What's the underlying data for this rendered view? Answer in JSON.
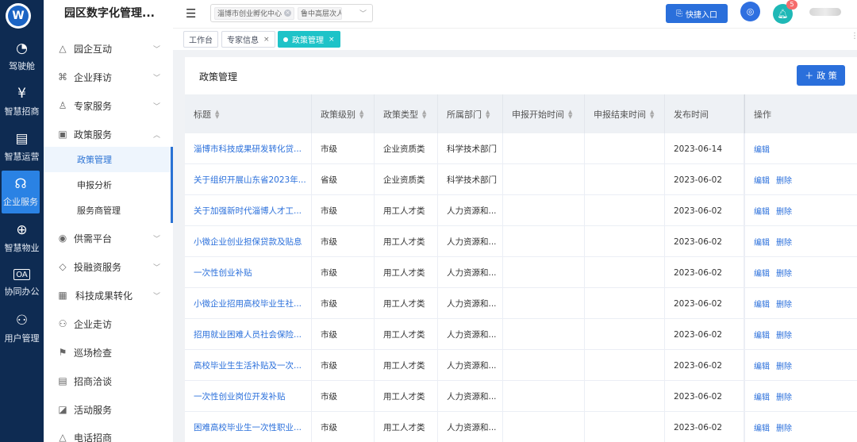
{
  "rail": {
    "logo": "W",
    "items": [
      {
        "label": "驾驶舱",
        "icon": "◔"
      },
      {
        "label": "智慧招商",
        "icon": "¥"
      },
      {
        "label": "智慧运营",
        "icon": "▤"
      },
      {
        "label": "企业服务",
        "icon": "☊"
      },
      {
        "label": "智慧物业",
        "icon": "⊕"
      },
      {
        "label": "协同办公",
        "icon": "OA"
      },
      {
        "label": "用户管理",
        "icon": "⚇"
      }
    ]
  },
  "sidebar": {
    "title": "园区数字化管理...",
    "menus": [
      {
        "label": "园企互动",
        "icon": "△"
      },
      {
        "label": "企业拜访",
        "icon": "⌘"
      },
      {
        "label": "专家服务",
        "icon": "♙"
      },
      {
        "label": "政策服务",
        "icon": "▣"
      },
      {
        "label": "供需平台",
        "icon": "◉"
      },
      {
        "label": "投融资服务",
        "icon": "◇"
      },
      {
        "label": "科技成果转化",
        "icon": "▦"
      },
      {
        "label": "企业走访",
        "icon": "⚇"
      },
      {
        "label": "巡场检查",
        "icon": "⚑"
      },
      {
        "label": "招商洽谈",
        "icon": "▤"
      },
      {
        "label": "活动服务",
        "icon": "◪"
      },
      {
        "label": "电话招商",
        "icon": "△"
      }
    ],
    "submenus": [
      "政策管理",
      "申报分析",
      "服务商管理"
    ]
  },
  "header": {
    "tags": [
      "淄博市创业孵化中心",
      "鲁中高层次人才"
    ],
    "quick_label": "快捷入口",
    "badge_count": "5"
  },
  "tabs": [
    {
      "label": "工作台"
    },
    {
      "label": "专家信息"
    },
    {
      "label": "政策管理"
    }
  ],
  "card": {
    "title": "政策管理",
    "add_label": "政 策",
    "columns": [
      "标题",
      "政策级别",
      "政策类型",
      "所属部门",
      "申报开始时间",
      "申报结束时间",
      "发布时间",
      "操作"
    ],
    "edit_label": "编辑",
    "delete_label": "删除",
    "rows": [
      {
        "title": "淄博市科技成果研发转化贷...",
        "level": "市级",
        "type": "企业资质类",
        "dept": "科学技术部门",
        "start": "",
        "end": "",
        "date": "2023-06-14",
        "can_delete": false
      },
      {
        "title": "关于组织开展山东省2023年...",
        "level": "省级",
        "type": "企业资质类",
        "dept": "科学技术部门",
        "start": "",
        "end": "",
        "date": "2023-06-02",
        "can_delete": true
      },
      {
        "title": "关于加强新时代淄博人才工...",
        "level": "市级",
        "type": "用工人才类",
        "dept": "人力资源和...",
        "start": "",
        "end": "",
        "date": "2023-06-02",
        "can_delete": true
      },
      {
        "title": "小微企业创业担保贷款及贴息",
        "level": "市级",
        "type": "用工人才类",
        "dept": "人力资源和...",
        "start": "",
        "end": "",
        "date": "2023-06-02",
        "can_delete": true
      },
      {
        "title": "一次性创业补贴",
        "level": "市级",
        "type": "用工人才类",
        "dept": "人力资源和...",
        "start": "",
        "end": "",
        "date": "2023-06-02",
        "can_delete": true
      },
      {
        "title": "小微企业招用高校毕业生社...",
        "level": "市级",
        "type": "用工人才类",
        "dept": "人力资源和...",
        "start": "",
        "end": "",
        "date": "2023-06-02",
        "can_delete": true
      },
      {
        "title": "招用就业困难人员社会保险...",
        "level": "市级",
        "type": "用工人才类",
        "dept": "人力资源和...",
        "start": "",
        "end": "",
        "date": "2023-06-02",
        "can_delete": true
      },
      {
        "title": "高校毕业生生活补贴及一次...",
        "level": "市级",
        "type": "用工人才类",
        "dept": "人力资源和...",
        "start": "",
        "end": "",
        "date": "2023-06-02",
        "can_delete": true
      },
      {
        "title": "一次性创业岗位开发补贴",
        "level": "市级",
        "type": "用工人才类",
        "dept": "人力资源和...",
        "start": "",
        "end": "",
        "date": "2023-06-02",
        "can_delete": true
      },
      {
        "title": "困难高校毕业生一次性职业...",
        "level": "市级",
        "type": "用工人才类",
        "dept": "人力资源和...",
        "start": "",
        "end": "",
        "date": "2023-06-02",
        "can_delete": true
      }
    ]
  }
}
